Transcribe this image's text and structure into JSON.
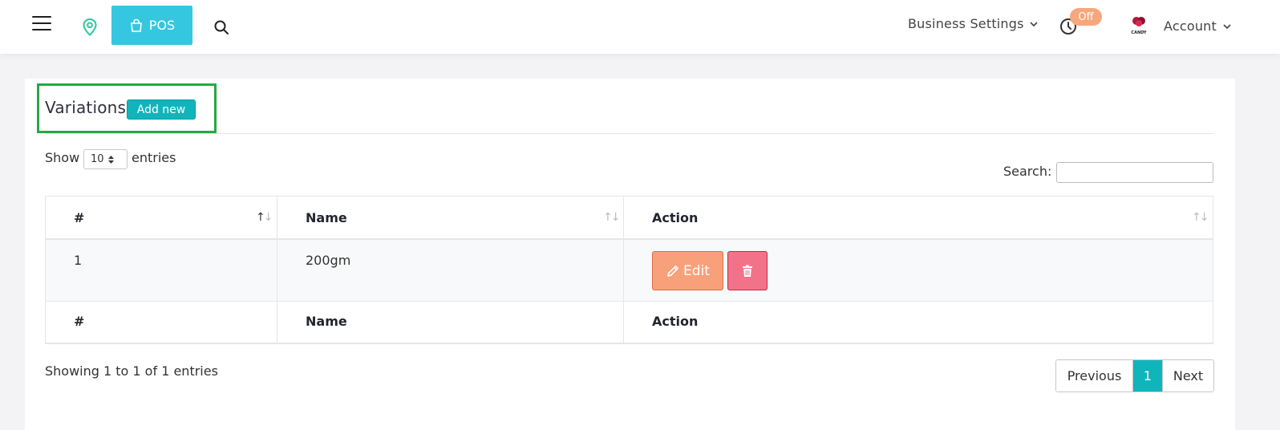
{
  "navbar": {
    "pos_label": "POS",
    "business_settings_label": "Business Settings",
    "clock_badge": "Off",
    "logo_text": "CANDY",
    "account_label": "Account"
  },
  "card": {
    "title": "Variations",
    "add_new_label": "Add new",
    "show_label": "Show",
    "entries_value": "10",
    "entries_label": "entries",
    "search_label": "Search:",
    "search_value": ""
  },
  "table": {
    "headers": [
      "#",
      "Name",
      "Action"
    ],
    "rows": [
      {
        "index": "1",
        "name": "200gm",
        "edit_label": "Edit"
      }
    ],
    "footers": [
      "#",
      "Name",
      "Action"
    ]
  },
  "footer": {
    "info": "Showing 1 to 1 of 1 entries",
    "prev_label": "Previous",
    "current_page": "1",
    "next_label": "Next"
  },
  "colors": {
    "pos_button": "#35c7e0",
    "accent": "#10b5bc",
    "edit_button": "#f8a07a",
    "delete_button": "#f27389",
    "badge": "#f7a77d",
    "highlight_border": "#27a844"
  },
  "icons": {
    "menu": "hamburger-icon",
    "location": "map-pin-icon",
    "bag": "shopping-bag-icon",
    "search": "search-icon",
    "clock": "clock-icon",
    "edit": "pencil-icon",
    "delete": "trash-icon",
    "sort": "sort-icon",
    "dropdown": "chevron-down-icon"
  }
}
